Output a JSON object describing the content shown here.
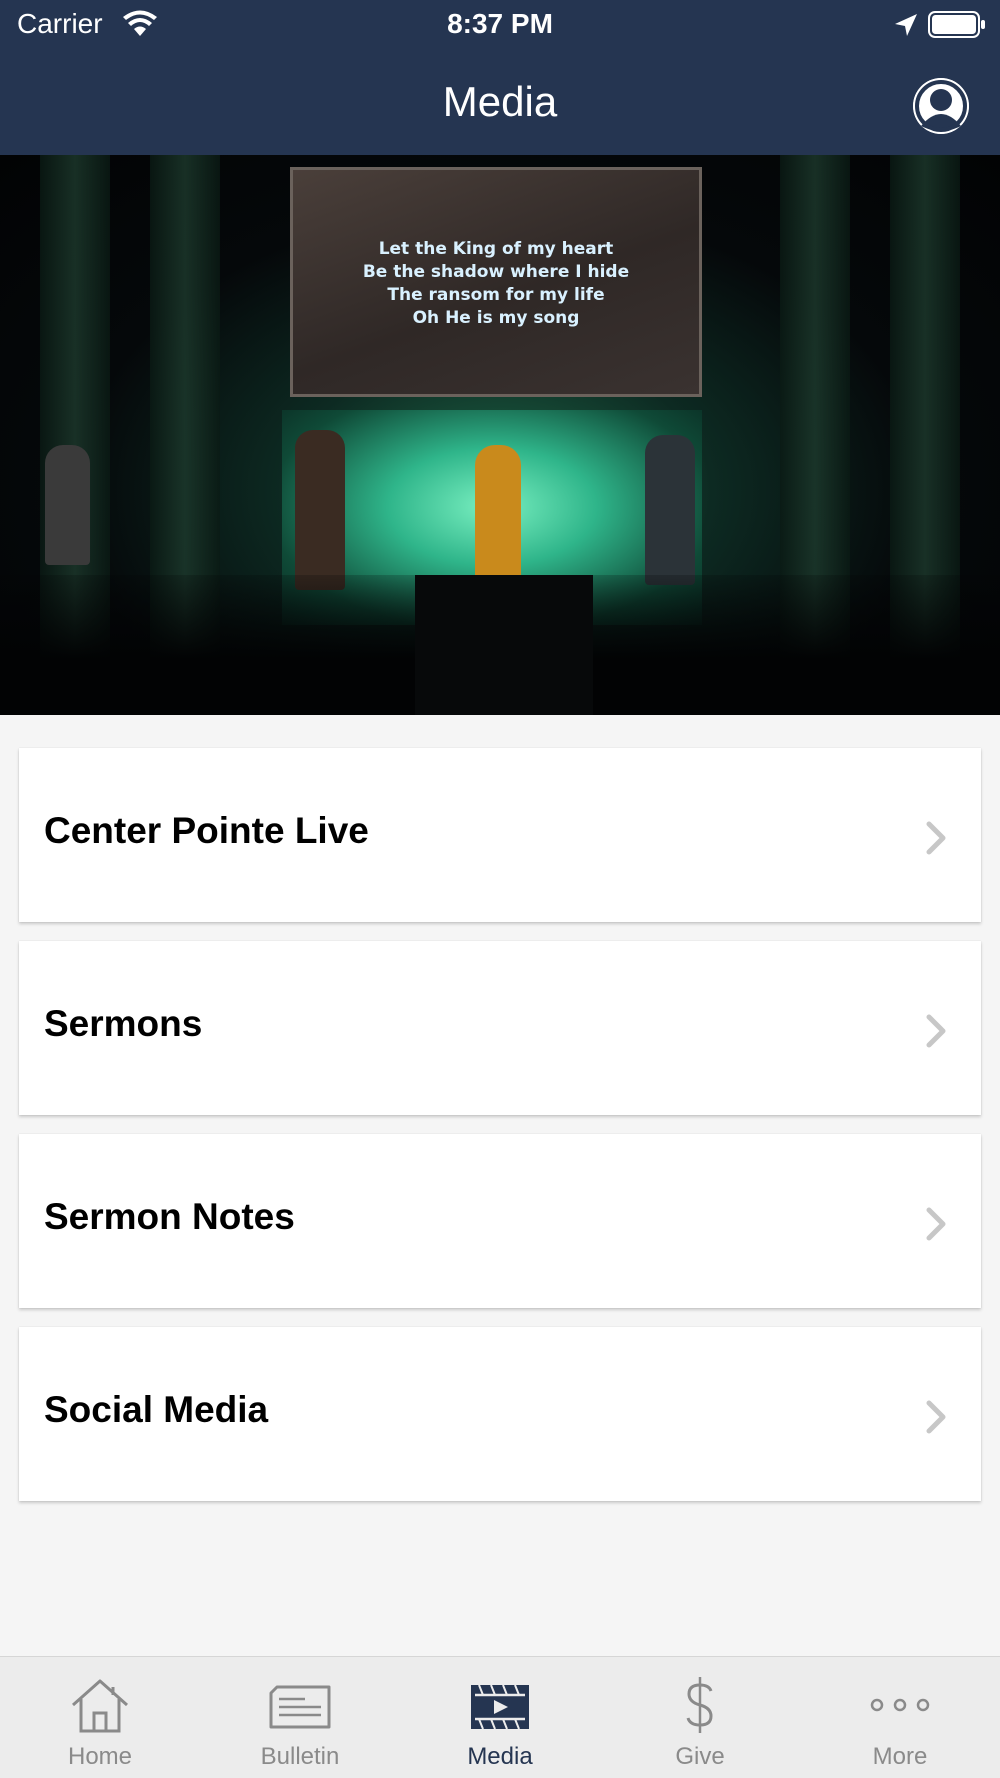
{
  "status_bar": {
    "carrier": "Carrier",
    "time": "8:37 PM"
  },
  "nav": {
    "title": "Media"
  },
  "hero": {
    "lyrics": [
      "Let the King of my heart",
      "Be the shadow where I hide",
      "The ransom for my life",
      "Oh He is my song"
    ]
  },
  "menu": {
    "items": [
      {
        "label": "Center Pointe Live"
      },
      {
        "label": "Sermons"
      },
      {
        "label": "Sermon Notes"
      },
      {
        "label": "Social Media"
      }
    ]
  },
  "tabbar": {
    "tabs": [
      {
        "label": "Home",
        "icon": "home-icon"
      },
      {
        "label": "Bulletin",
        "icon": "bulletin-icon"
      },
      {
        "label": "Media",
        "icon": "media-icon",
        "active": true
      },
      {
        "label": "Give",
        "icon": "dollar-icon"
      },
      {
        "label": "More",
        "icon": "more-icon"
      }
    ]
  },
  "colors": {
    "nav_background": "#253551",
    "active_tab": "#253551",
    "inactive_tab": "#8a8a8a",
    "page_background": "#f5f5f5"
  }
}
